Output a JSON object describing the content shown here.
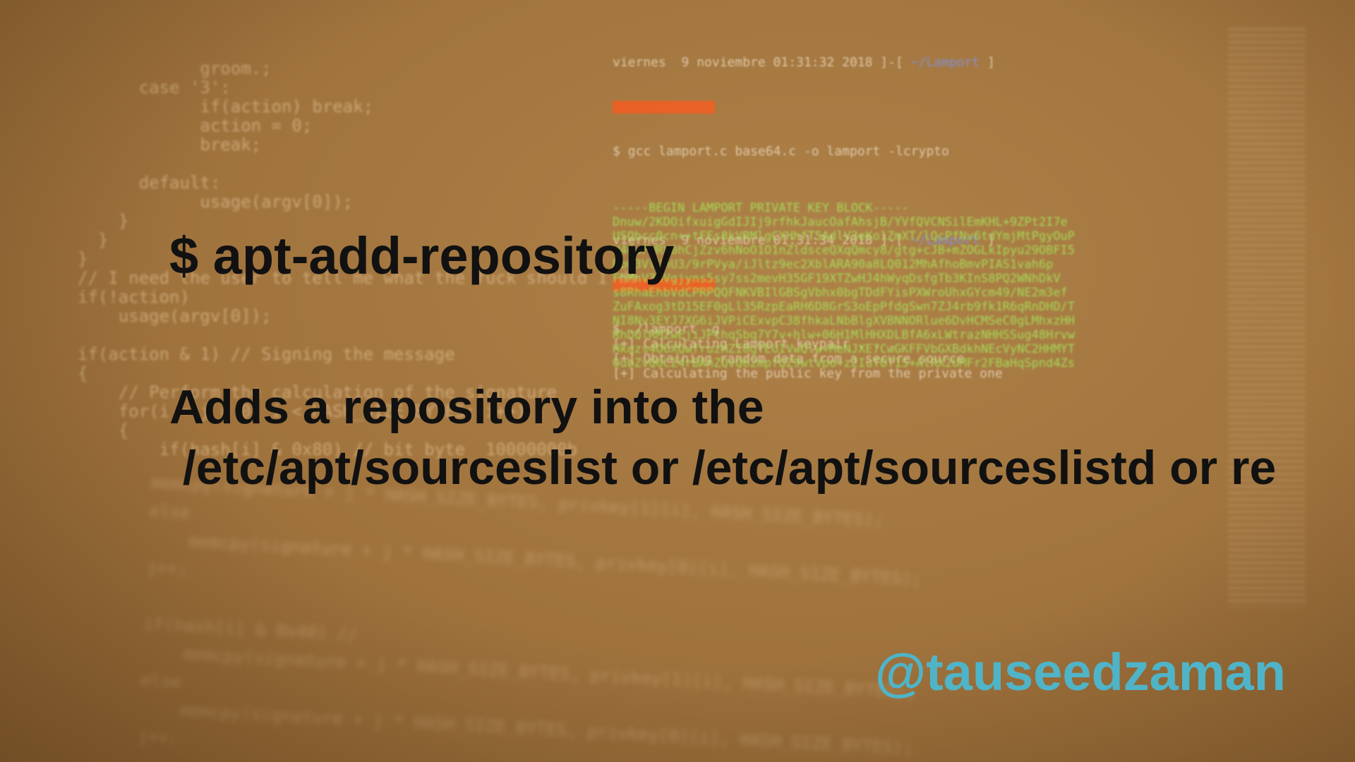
{
  "command": "$ apt-add-repository",
  "description": {
    "line1": "Adds a repository into the",
    "line2": " /etc/apt/sourceslist or /etc/apt/sourceslistd or re"
  },
  "author_handle": "@tauseedzaman",
  "background": {
    "left_code": "            groom.;\n      case '3':\n            if(action) break;\n            action = 0;\n            break;\n\n      default:\n            usage(argv[0]);\n    }\n  }\n}\n// I need the user to tell me what the fuck should I do\nif(!action)\n    usage(argv[0]);\n\nif(action & 1) // Signing the message\n{\n    // Perform the calculation of the signature\n    for(i = j = 0; i < HASH_SIZE_BYTES; i++)\n    {\n        if(hash[i] & 0x80) // bit byte  10000000b",
    "left_code_lower": "memcpy(signature + j * HASH_SIZE_BYTES, privkey[1][i], HASH_SIZE_BYTES);\nelse\n    memcpy(signature + j * HASH_SIZE_BYTES, privkey[0][i], HASH_SIZE_BYTES);\nj++;\n\nif(hash[i] & 0x40) //\n    memcpy(signature + j * HASH_SIZE_BYTES, privkey[1][i], HASH_SIZE_BYTES);\nelse\n    memcpy(signature + j * HASH_SIZE_BYTES, privkey[0][i], HASH_SIZE_BYTES);\nj++;",
    "terminal_header1": "viernes  9 noviembre 01:31:32 2018 ]-[ ",
    "terminal_path": "~/Lamport",
    "terminal_cmd1": "$ gcc lamport.c base64.c -o lamport -lcrypto",
    "terminal_header2": "viernes  9 noviembre 01:31:34 2018 ]-[ ",
    "terminal_output": "$ ./lamport -g\n[+] Calculating Lamport keypair . . .\n[+] Obtaining random data from a secure source\n[+] Calculating the public key from the private one",
    "key_block": "-----BEGIN LAMPORT PRIVATE KEY BLOCK-----\nDnuw/2KDOifxuigGdIJIj9rfhkJaucOafAhsjB/YVfQVCNSilEmKHL+9ZPt2I7e\nUSQbcc0cn++tFEs8kVRMlgCYHhfT5AdlV3eKo1ZmXT/lQcPfNv6tdYmjMtPgyOuP\nW46wFWRV0hCjZzv6hNoO1O1nZldsceQXqQmcy8/gtg+cJB+mZOGLkIpyu29OBFI5\nRbw3VlUhU3/9rPVya/iJltz9ec2XblARA90a8LQ012MhAfhoBmvPIAS1vah6p\nFhMnV3hVgjyns5sy7ss2mevH35GF19XTZwHJ4hWyqDsfgTb3KInS8PQ2WNhDkV\ns8RhaEhbVdCPRPQQFNKVBIlGBSgVbhx0bgTDdFYisPXWroUhxGYcm49/NE2m3ef\nZuFAxog3tD15EF0gLl35RzpEaRH6D8GrS3oEpPfdgSwn7ZJ4rb9fk1R6qRnDHD/T\nNI8Nv3EYJ7XG6iJVPiCExvpC38fhkaLNbBlgXVBNNORlue6DvHCMSeC0gLMhxzHH\nRhDQlRMZwEjiJPthqSbq7Y7v+hlw+06H1MlHHXDLBfA6xLWtrazNHHSSug48Hrvw\nHkqzs4O6XQwfruzHZI0gTEUIVwQlw+MeNJXE7CwGKFFVbGXBdkhNEcVyNC2HHMYT\nOubZvQ6CZ4rBAhZQvQ62mpfQZ9wtVpo+z2IuTOT1S+AlRX2UMFr2FBaHqSpnd4Zs"
  },
  "colors": {
    "background": "#a2753f",
    "text": "#111111",
    "handle": "#4fb4c8",
    "key_text": "#a5eb5a",
    "prompt_bar": "#ff5a1e"
  }
}
